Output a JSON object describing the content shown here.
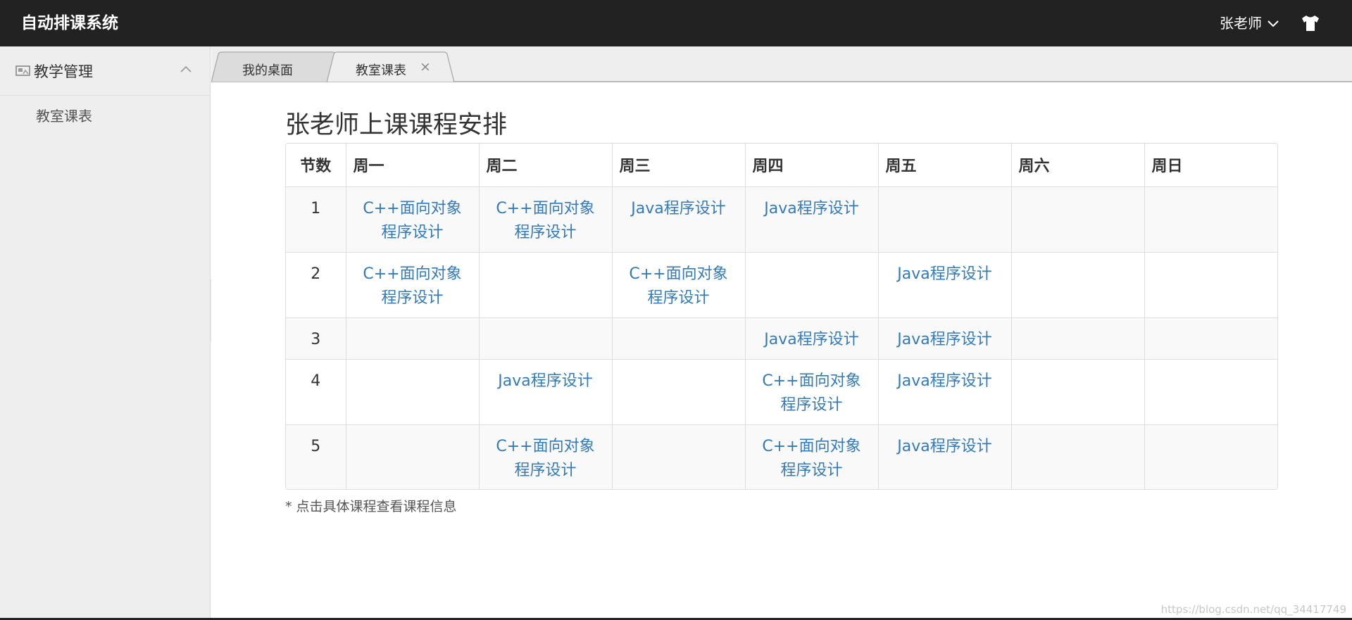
{
  "header": {
    "app_title": "自动排课系统",
    "user_name": "张老师",
    "user_dropdown_icon": "chevron-down-icon",
    "skin_icon": "tshirt-icon"
  },
  "sidebar": {
    "group_icon": "picture-icon",
    "group_label": "教学管理",
    "group_chevron_icon": "chevron-up-icon",
    "items": [
      {
        "label": "教室课表"
      }
    ]
  },
  "tabs": [
    {
      "label": "我的桌面",
      "active": false
    },
    {
      "label": "教室课表",
      "active": true,
      "close": "×"
    }
  ],
  "page": {
    "title": "张老师上课课程安排",
    "footnote": "* 点击具体课程查看课程信息",
    "watermark": "https://blog.csdn.net/qq_34417749"
  },
  "schedule": {
    "headers": [
      "节数",
      "周一",
      "周二",
      "周三",
      "周四",
      "周五",
      "周六",
      "周日"
    ],
    "rows": [
      {
        "num": "1",
        "cells": [
          "C++面向对象程序设计",
          "C++面向对象程序设计",
          "Java程序设计",
          "Java程序设计",
          "",
          "",
          ""
        ]
      },
      {
        "num": "2",
        "cells": [
          "C++面向对象程序设计",
          "",
          "C++面向对象程序设计",
          "",
          "Java程序设计",
          "",
          ""
        ]
      },
      {
        "num": "3",
        "cells": [
          "",
          "",
          "",
          "Java程序设计",
          "Java程序设计",
          "",
          ""
        ]
      },
      {
        "num": "4",
        "cells": [
          "",
          "Java程序设计",
          "",
          "C++面向对象程序设计",
          "Java程序设计",
          "",
          ""
        ]
      },
      {
        "num": "5",
        "cells": [
          "",
          "C++面向对象程序设计",
          "",
          "C++面向对象程序设计",
          "Java程序设计",
          "",
          ""
        ]
      }
    ]
  },
  "colors": {
    "topbar_bg": "#222222",
    "sidebar_bg": "#eeeeee",
    "link": "#337ab7",
    "stripe": "#f9f9f9",
    "border": "#dddddd"
  }
}
